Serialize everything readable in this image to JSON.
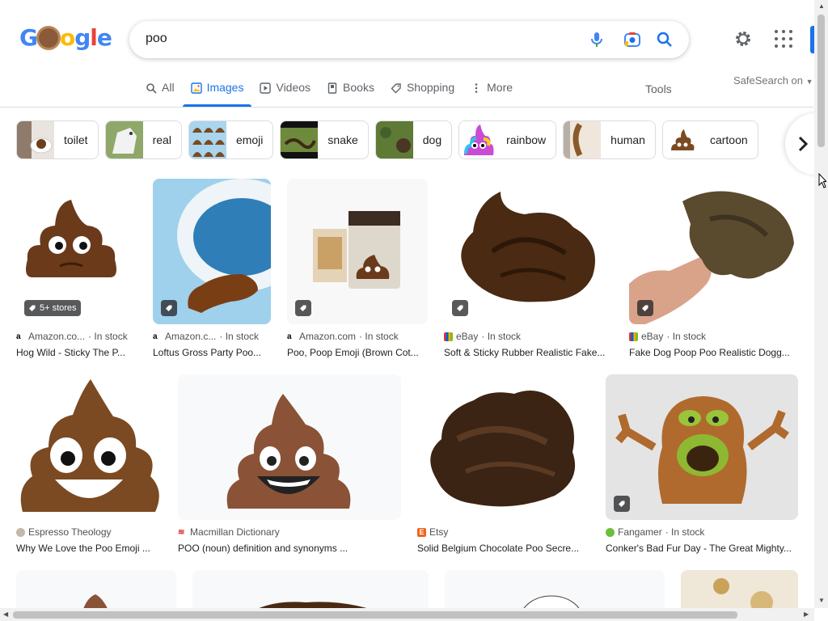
{
  "query": "poo",
  "tabs": [
    {
      "label": "All",
      "icon": "search-icon"
    },
    {
      "label": "Images",
      "icon": "image-icon"
    },
    {
      "label": "Videos",
      "icon": "play-icon"
    },
    {
      "label": "Books",
      "icon": "book-icon"
    },
    {
      "label": "Shopping",
      "icon": "tag-icon"
    },
    {
      "label": "More",
      "icon": "more-vert-icon"
    }
  ],
  "tools_label": "Tools",
  "safesearch_label": "SafeSearch on",
  "chips": [
    {
      "label": "toilet"
    },
    {
      "label": "real"
    },
    {
      "label": "emoji"
    },
    {
      "label": "snake"
    },
    {
      "label": "dog"
    },
    {
      "label": "rainbow"
    },
    {
      "label": "human"
    },
    {
      "label": "cartoon"
    }
  ],
  "results": [
    {
      "source": "Amazon.co...",
      "stock": "· In stock",
      "title": "Hog Wild - Sticky The P...",
      "badge": "5+ stores"
    },
    {
      "source": "Amazon.c...",
      "stock": "· In stock",
      "title": "Loftus Gross Party Poo...",
      "badge": ""
    },
    {
      "source": "Amazon.com",
      "stock": "· In stock",
      "title": "Poo, Poop Emoji (Brown Cot...",
      "badge": ""
    },
    {
      "source": "eBay",
      "stock": "· In stock",
      "title": "Soft & Sticky Rubber Realistic Fake...",
      "badge": ""
    },
    {
      "source": "eBay",
      "stock": "· In stock",
      "title": "Fake Dog Poop Poo Realistic Dogg...",
      "badge": ""
    },
    {
      "source": "Espresso Theology",
      "stock": "",
      "title": "Why We Love the Poo Emoji ...",
      "badge": ""
    },
    {
      "source": "Macmillan Dictionary",
      "stock": "",
      "title": "POO (noun) definition and synonyms ...",
      "badge": ""
    },
    {
      "source": "Etsy",
      "stock": "",
      "title": "Solid Belgium Chocolate Poo Secre...",
      "badge": ""
    },
    {
      "source": "Fangamer",
      "stock": "· In stock",
      "title": "Conker's Bad Fur Day - The Great Mighty...",
      "badge": ""
    }
  ],
  "colors": {
    "accent": "#1a73e8",
    "poo": "#6b3f1d"
  }
}
